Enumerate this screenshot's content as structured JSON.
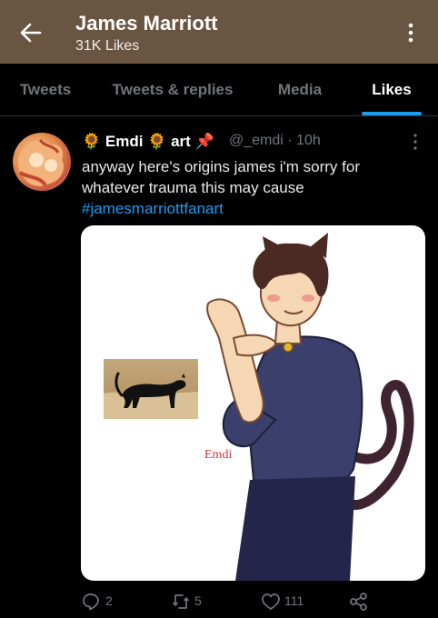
{
  "header": {
    "title": "James Marriott",
    "subtitle": "31K Likes",
    "back_icon": "arrow-left-icon",
    "more_icon": "more-vertical-icon",
    "background": "#6a5543"
  },
  "tabs": [
    {
      "label": "Tweets",
      "active": false
    },
    {
      "label": "Tweets & replies",
      "active": false
    },
    {
      "label": "Media",
      "active": false
    },
    {
      "label": "Likes",
      "active": true
    }
  ],
  "tweet": {
    "display_name": "🌻 Emdi 🌻 art 📌",
    "handle": "@_emdi · 10h",
    "text_line1": "anyway here's origins james i'm sorry for",
    "text_line2": "whatever trauma this may cause",
    "hashtag": "#jamesmarriottfanart",
    "drawing_signature": "Emdi",
    "actions": [
      {
        "name": "reply",
        "icon": "reply-icon",
        "count": "2"
      },
      {
        "name": "retweet",
        "icon": "retweet-icon",
        "count": "5"
      },
      {
        "name": "like",
        "icon": "heart-icon",
        "count": "111"
      },
      {
        "name": "share",
        "icon": "share-icon",
        "count": ""
      }
    ]
  },
  "colors": {
    "accent": "#1d9bf0",
    "background": "#000000",
    "muted_text": "#71767b"
  }
}
